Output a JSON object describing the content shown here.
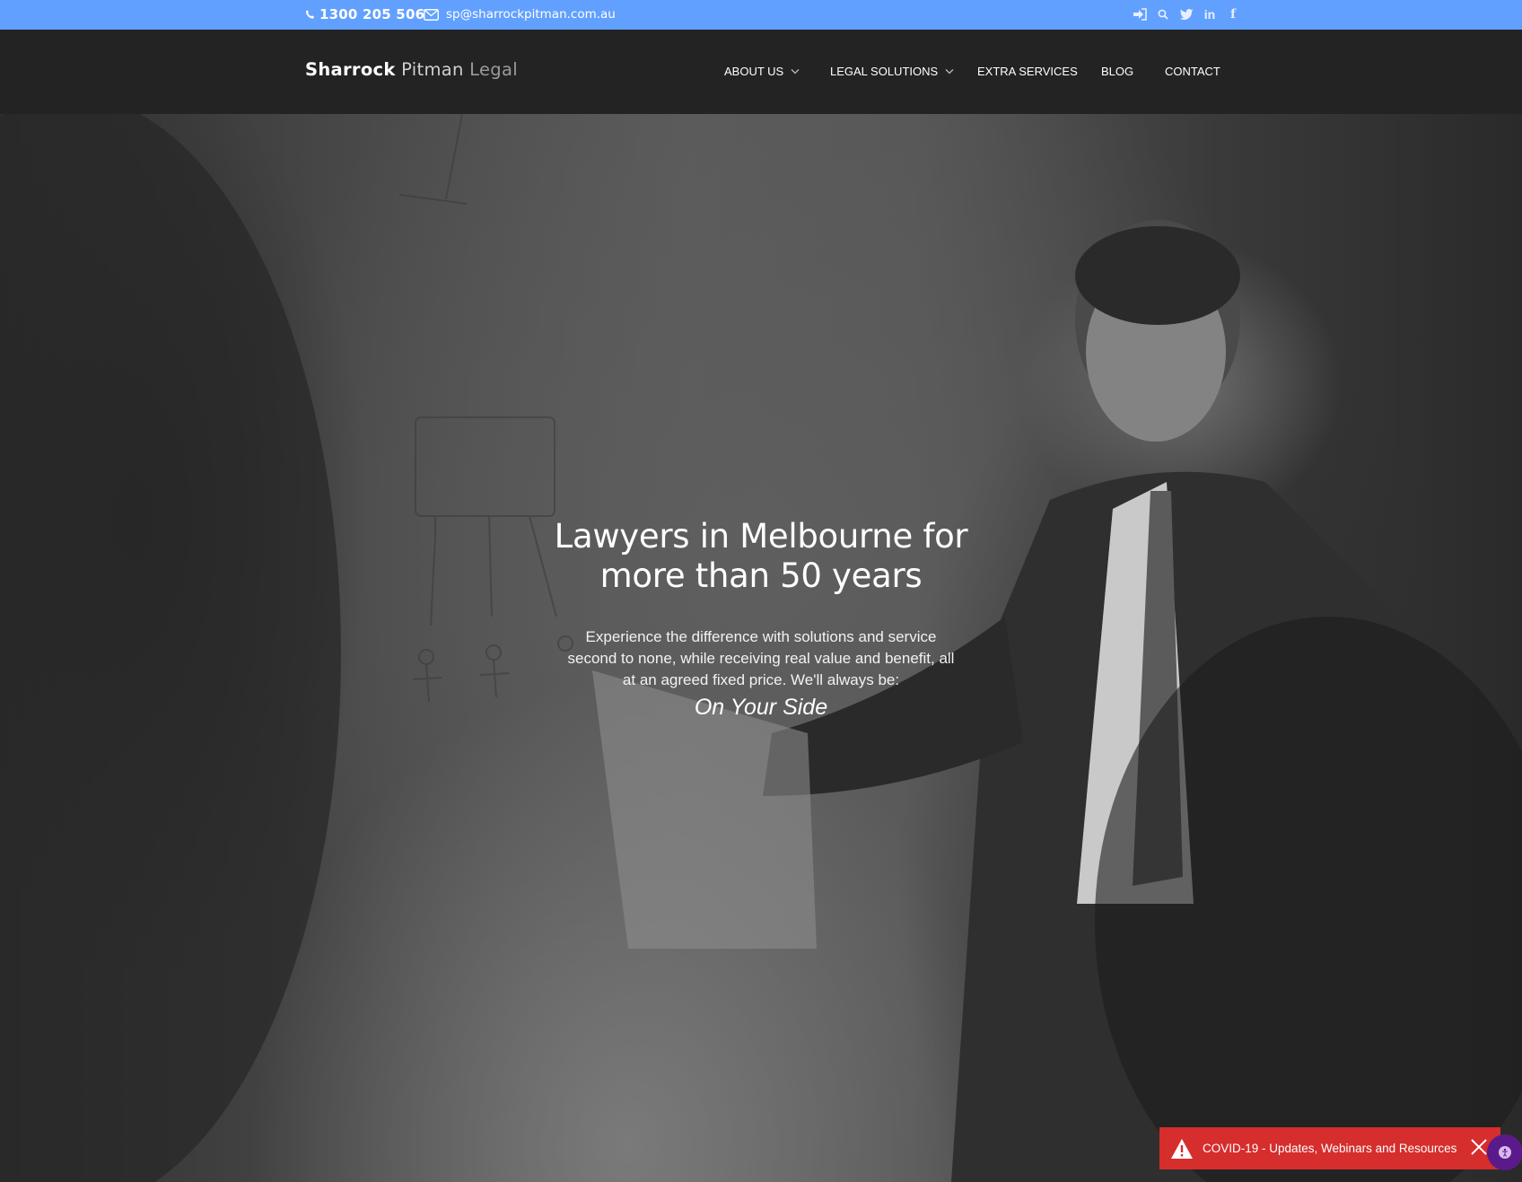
{
  "topbar": {
    "phone": "1300 205 506",
    "email": "sp@sharrockpitman.com.au",
    "icons": [
      "login-icon",
      "search-icon",
      "twitter-icon",
      "linkedin-icon",
      "facebook-icon"
    ],
    "linkedin_glyph": "in",
    "facebook_glyph": "f"
  },
  "logo": {
    "part1": "Sharrock",
    "part2": "Pitman",
    "part3": "Legal"
  },
  "nav": {
    "items": [
      {
        "label": "ABOUT US",
        "has_dropdown": true
      },
      {
        "label": "LEGAL SOLUTIONS",
        "has_dropdown": true
      },
      {
        "label": "EXTRA SERVICES",
        "has_dropdown": false
      },
      {
        "label": "BLOG",
        "has_dropdown": false
      },
      {
        "label": "CONTACT",
        "has_dropdown": false
      }
    ]
  },
  "hero": {
    "title_line1": "Lawyers in Melbourne for",
    "title_line2": "more than 50 years",
    "body": "Experience the difference with solutions and service second to none, while receiving real value and benefit, all at an agreed fixed price. We'll always be:",
    "tagline": "On Your Side"
  },
  "notice": {
    "text": "COVID-19 - Updates, Webinars and Resources"
  },
  "colors": {
    "topbar": "#62a0ff",
    "header": "#232323",
    "notice": "#d62d2d",
    "accessibility": "#5b1a8a"
  }
}
